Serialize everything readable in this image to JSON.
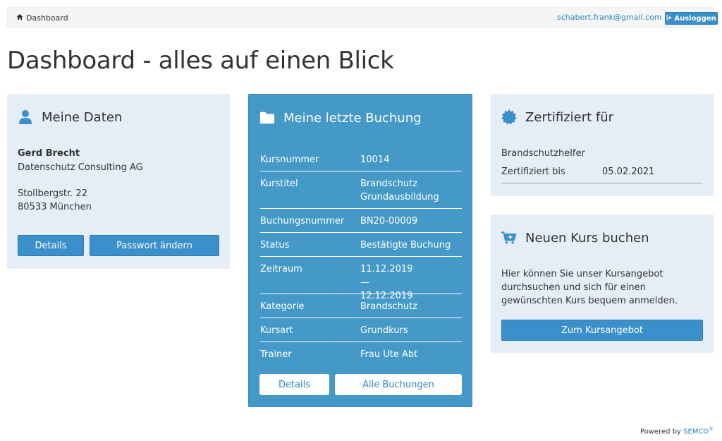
{
  "topbar": {
    "breadcrumb": "Dashboard",
    "email": "schabert.frank@gmail.com",
    "logout_label": "Ausloggen"
  },
  "page": {
    "title": "Dashboard - alles auf einen Blick"
  },
  "daten": {
    "title": "Meine Daten",
    "name": "Gerd Brecht",
    "company": "Datenschutz Consulting AG",
    "street": "Stollbergstr. 22",
    "city": "80533 München",
    "details_label": "Details",
    "password_label": "Passwort ändern"
  },
  "buchung": {
    "title": "Meine letzte Buchung",
    "rows": [
      {
        "key": "Kursnummer",
        "value": "10014"
      },
      {
        "key": "Kurstitel",
        "value": "Brandschutz Grundausbildung"
      },
      {
        "key": "Buchungsnummer",
        "value": "BN20-00009"
      },
      {
        "key": "Status",
        "value": "Bestätigte Buchung"
      },
      {
        "key": "Zeitraum",
        "value": "11.12.2019 — 12.12.2019"
      },
      {
        "key": "Kategorie",
        "value": "Brandschutz"
      },
      {
        "key": "Kursart",
        "value": "Grundkurs"
      },
      {
        "key": "Trainer",
        "value": "Frau Ute Abt"
      }
    ],
    "details_label": "Details",
    "all_label": "Alle Buchungen"
  },
  "zert": {
    "title": "Zertifiziert für",
    "item": "Brandschutzhelfer",
    "until_label": "Zertifiziert bis",
    "until_value": "05.02.2021"
  },
  "kurs": {
    "title": "Neuen Kurs buchen",
    "description": "Hier können Sie unser Kursangebot durchsuchen und sich für einen gewünschten Kurs bequem anmelden.",
    "button_label": "Zum Kursangebot"
  },
  "footer": {
    "powered_by": "Powered by",
    "brand": "SEMCO",
    "reg": "®"
  },
  "colors": {
    "accent": "#3b8fcb",
    "panel_bg": "#e5eef7",
    "booking_bg": "#4499c9"
  }
}
